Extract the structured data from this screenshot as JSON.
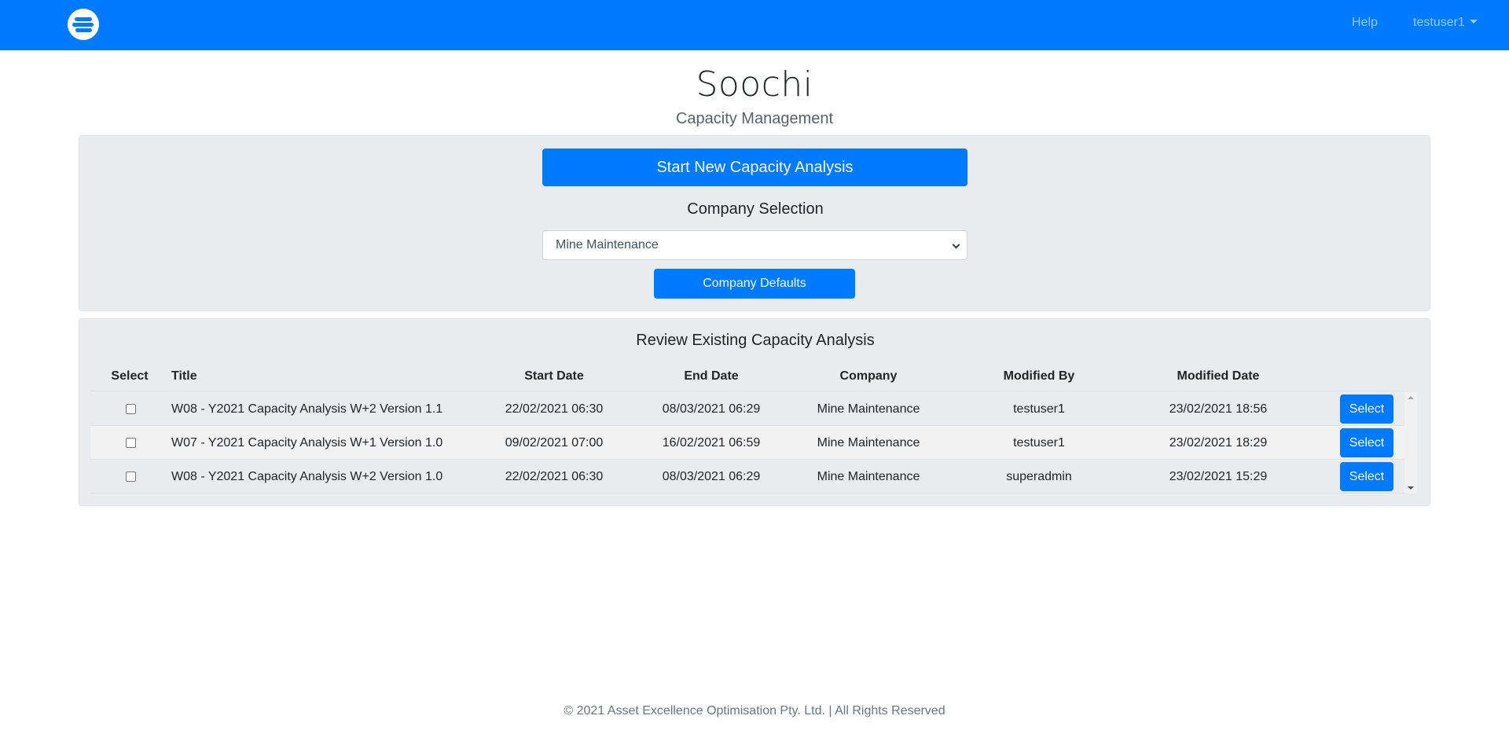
{
  "navbar": {
    "logo_icon": "soochi-logo-icon",
    "help_label": "Help",
    "user_label": "testuser1",
    "accent_color": "#007bff"
  },
  "header": {
    "title": "Soochi",
    "subtitle": "Capacity Management"
  },
  "analysis_panel": {
    "start_button_label": "Start New Capacity Analysis",
    "company_heading": "Company Selection",
    "company_select_value": "Mine Maintenance",
    "defaults_button_label": "Company Defaults"
  },
  "review_panel": {
    "heading": "Review Existing Capacity Analysis",
    "columns": [
      "Select",
      "Title",
      "Start Date",
      "End Date",
      "Company",
      "Modified By",
      "Modified Date"
    ],
    "rows": [
      {
        "title": "W08 - Y2021 Capacity Analysis W+2 Version 1.1",
        "start_date": "22/02/2021 06:30",
        "end_date": "08/03/2021 06:29",
        "company": "Mine Maintenance",
        "modified_by": "testuser1",
        "modified_date": "23/02/2021 18:56",
        "action_label": "Select",
        "checked": false
      },
      {
        "title": "W07 - Y2021 Capacity Analysis W+1 Version 1.0",
        "start_date": "09/02/2021 07:00",
        "end_date": "16/02/2021 06:59",
        "company": "Mine Maintenance",
        "modified_by": "testuser1",
        "modified_date": "23/02/2021 18:29",
        "action_label": "Select",
        "checked": false
      },
      {
        "title": "W08 - Y2021 Capacity Analysis W+2 Version 1.0",
        "start_date": "22/02/2021 06:30",
        "end_date": "08/03/2021 06:29",
        "company": "Mine Maintenance",
        "modified_by": "superadmin",
        "modified_date": "23/02/2021 15:29",
        "action_label": "Select",
        "checked": false
      }
    ]
  },
  "footer": {
    "text": "© 2021 Asset Excellence Optimisation Pty. Ltd. | All Rights Reserved"
  }
}
